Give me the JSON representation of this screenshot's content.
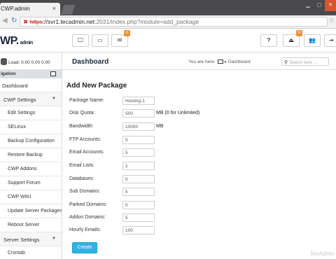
{
  "browser": {
    "tab_title": "CWP.admin",
    "tab_close": "×",
    "url_scheme": "https",
    "url_host": "://svr1.tecadmin.net",
    "url_path": ":2031/index.php?module=add_package"
  },
  "header": {
    "logo": "WP.",
    "logo_suffix": "admin",
    "mail_badge": "0",
    "notif_badge": "0",
    "help_label": "?"
  },
  "sidebar": {
    "load_text": "Load: 0.00  0.00  0.00",
    "nav_heading": "igation",
    "items": [
      {
        "label": "Dashboard"
      },
      {
        "label": "CWP Settings"
      },
      {
        "label": "Edit Settings"
      },
      {
        "label": "SELinux"
      },
      {
        "label": "Backup Configuration"
      },
      {
        "label": "Restore Backup"
      },
      {
        "label": "CWP Addons"
      },
      {
        "label": "Support Forum"
      },
      {
        "label": "CWP WIKI"
      },
      {
        "label": "Update Server Packages"
      },
      {
        "label": "Reboot Server"
      },
      {
        "label": "Server Settings"
      },
      {
        "label": "Crontab"
      }
    ]
  },
  "content": {
    "page_title": "Dashboard",
    "breadcrumb_prefix": "You are here:",
    "breadcrumb_sep": "▸",
    "breadcrumb_page": "Dashboard",
    "search_placeholder": "Search here ..."
  },
  "form": {
    "title": "Add New Package",
    "fields": [
      {
        "label": "Package Name:",
        "value": "Hosting-1",
        "unit": ""
      },
      {
        "label": "Disk Quota:",
        "value": "500",
        "unit": "MB (0 for Unlimited)"
      },
      {
        "label": "Bandwidth:",
        "value": "10000",
        "unit": "MB"
      },
      {
        "label": "FTP Accounts:",
        "value": "5",
        "unit": ""
      },
      {
        "label": "Email Accounts:",
        "value": "5",
        "unit": ""
      },
      {
        "label": "Email Lists:",
        "value": "1",
        "unit": ""
      },
      {
        "label": "Databases:",
        "value": "5",
        "unit": ""
      },
      {
        "label": "Sub Domains:",
        "value": "5",
        "unit": ""
      },
      {
        "label": "Parked Domains:",
        "value": "0",
        "unit": ""
      },
      {
        "label": "Addon Domains:",
        "value": "5",
        "unit": ""
      },
      {
        "label": "Hourly Emails:",
        "value": "100",
        "unit": ""
      }
    ],
    "submit_label": "Create"
  },
  "watermark": "TecAdmin",
  "colors": {
    "accent": "#2fb3e4",
    "badge": "#f0913a",
    "url_insecure": "#c0392b"
  }
}
